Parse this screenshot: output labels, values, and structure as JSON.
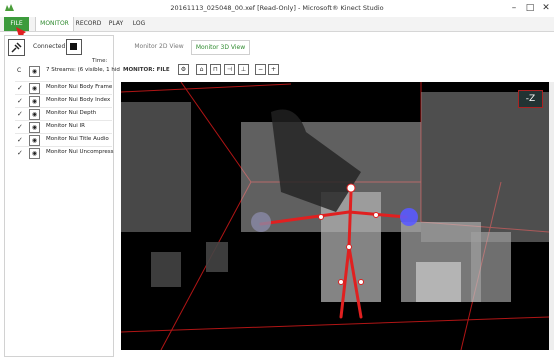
{
  "window": {
    "title": "20161113_025048_00.xef [Read-Only] - Microsoft® Kinect Studio",
    "controls": [
      "minimize-icon",
      "maximize-icon",
      "close-icon"
    ]
  },
  "menu": {
    "file": "FILE",
    "monitor": "MONITOR",
    "record": "RECORD",
    "play": "PLAY",
    "log": "LOG"
  },
  "left": {
    "connected": "Connected",
    "time": "Time:",
    "streams_prefix": "C",
    "streams": "7 Streams: (6 visible, 1 hid",
    "items": [
      {
        "label": "Monitor Nui Body Frame"
      },
      {
        "label": "Monitor Nui Body Index"
      },
      {
        "label": "Monitor Nui Depth"
      },
      {
        "label": "Monitor Nui IR"
      },
      {
        "label": "Monitor Nui Title Audio"
      },
      {
        "label": "Monitor Nui Uncompress"
      }
    ]
  },
  "views": {
    "tab2d": "Monitor 2D View",
    "tab3d": "Monitor 3D View",
    "monitor_label": "MONITOR: FILE"
  },
  "viewport": {
    "axis_badge": "-Z",
    "background": "#000000",
    "skeleton_color": "#e02020",
    "hand_color": "#5a5aff"
  },
  "colors": {
    "accent_green": "#3c9b3c",
    "tab_active_text": "#2d8a2d"
  }
}
